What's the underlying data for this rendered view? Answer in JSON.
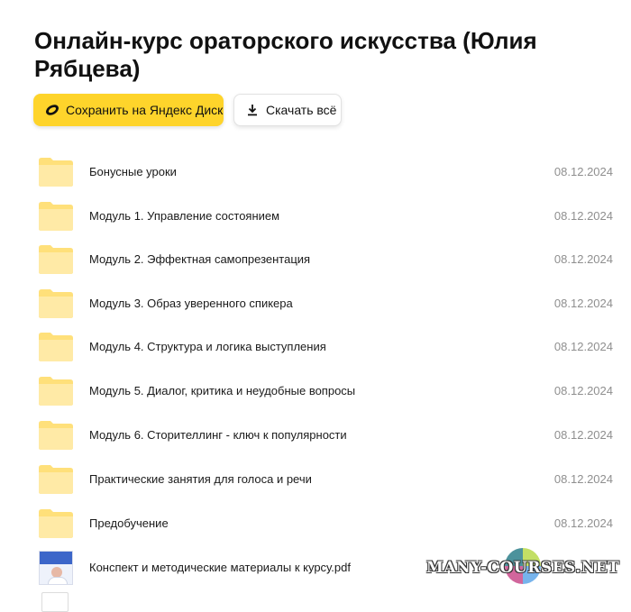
{
  "page": {
    "title": "Онлайн-курс ораторского искусства (Юлия Рябцева)"
  },
  "actions": {
    "save_label": "Сохранить на Яндекс Диск",
    "download_label": "Скачать всё"
  },
  "items": [
    {
      "name": "Бонусные уроки",
      "date": "08.12.2024",
      "type": "folder"
    },
    {
      "name": "Модуль 1. Управление состоянием",
      "date": "08.12.2024",
      "type": "folder"
    },
    {
      "name": "Модуль 2. Эффектная самопрезентация",
      "date": "08.12.2024",
      "type": "folder"
    },
    {
      "name": "Модуль 3. Образ уверенного спикера",
      "date": "08.12.2024",
      "type": "folder"
    },
    {
      "name": "Модуль 4. Структура и логика выступления",
      "date": "08.12.2024",
      "type": "folder"
    },
    {
      "name": "Модуль 5. Диалог, критика и неудобные вопросы",
      "date": "08.12.2024",
      "type": "folder"
    },
    {
      "name": "Модуль 6. Сторителлинг - ключ к популярности",
      "date": "08.12.2024",
      "type": "folder"
    },
    {
      "name": "Практические занятия для голоса и речи",
      "date": "08.12.2024",
      "type": "folder"
    },
    {
      "name": "Предобучение",
      "date": "08.12.2024",
      "type": "folder"
    },
    {
      "name": "Конспект и методические материалы к курсу.pdf",
      "date": "",
      "type": "pdf"
    }
  ],
  "watermark": "MANY-COURSES.NET",
  "colors": {
    "save_button": "#fed42b",
    "folder": "#ffe79a",
    "date_text": "#8f8f8f"
  }
}
